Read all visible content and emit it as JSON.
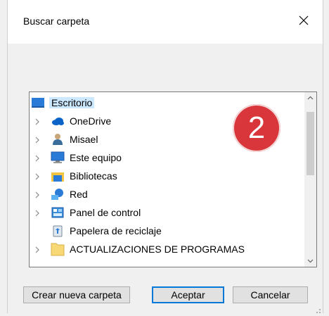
{
  "dialog": {
    "title": "Buscar carpeta"
  },
  "tree": {
    "items": [
      {
        "label": "Escritorio",
        "icon": "desktop-icon",
        "expandable": false,
        "selected": true
      },
      {
        "label": "OneDrive",
        "icon": "cloud-icon",
        "expandable": true
      },
      {
        "label": "Misael",
        "icon": "user-icon",
        "expandable": true
      },
      {
        "label": "Este equipo",
        "icon": "computer-icon",
        "expandable": true
      },
      {
        "label": "Bibliotecas",
        "icon": "library-icon",
        "expandable": true
      },
      {
        "label": "Red",
        "icon": "network-icon",
        "expandable": true
      },
      {
        "label": "Panel de control",
        "icon": "control-panel-icon",
        "expandable": true
      },
      {
        "label": "Papelera de reciclaje",
        "icon": "recycle-bin-icon",
        "expandable": false
      },
      {
        "label": "ACTUALIZACIONES DE PROGRAMAS",
        "icon": "folder-icon",
        "expandable": true
      }
    ]
  },
  "annotation": {
    "step": "2"
  },
  "buttons": {
    "new_folder": "Crear nueva carpeta",
    "ok": "Aceptar",
    "cancel": "Cancelar"
  },
  "colors": {
    "selection": "#cce8ff",
    "badge": "#d9363b",
    "accent": "#0078d7"
  }
}
